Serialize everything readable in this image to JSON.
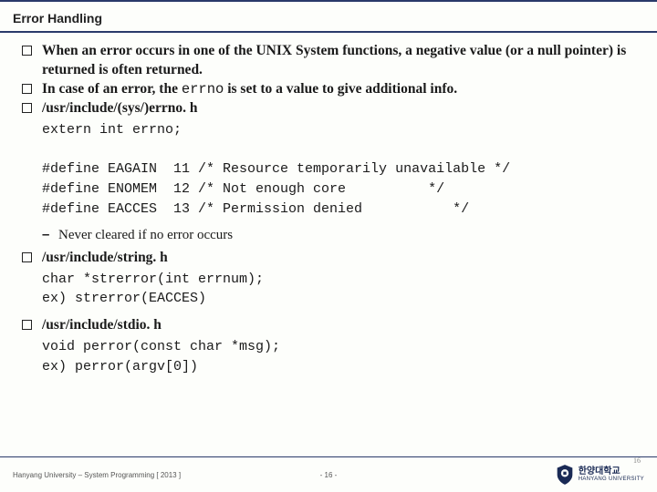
{
  "title": "Error Handling",
  "bullets": {
    "b1": "When an error occurs in one of the UNIX System functions, a negative value (or a null pointer) is returned is often returned.",
    "b2a": "In case of an error,  the ",
    "b2code": "errno",
    "b2b": " is set to a value to give additional info.",
    "b3": "/usr/include/(sys/)errno. h"
  },
  "code1": "extern int errno;\n\n#define EAGAIN  11 /* Resource temporarily unavailable */\n#define ENOMEM  12 /* Not enough core          */\n#define EACCES  13 /* Permission denied           */",
  "dash1": "Never cleared if no error occurs",
  "bullet4": "/usr/include/string. h",
  "code2": "char *strerror(int errnum);\nex) strerror(EACCES)",
  "bullet5": "/usr/include/stdio. h",
  "code3": "void perror(const char *msg);\nex) perror(argv[0])",
  "footer": {
    "left": "Hanyang University – System Programming  [ 2013 ]",
    "center": "- 16 -",
    "rightNum": "16",
    "logoKr": "한양대학교",
    "logoEn": "HANYANG UNIVERSITY"
  }
}
